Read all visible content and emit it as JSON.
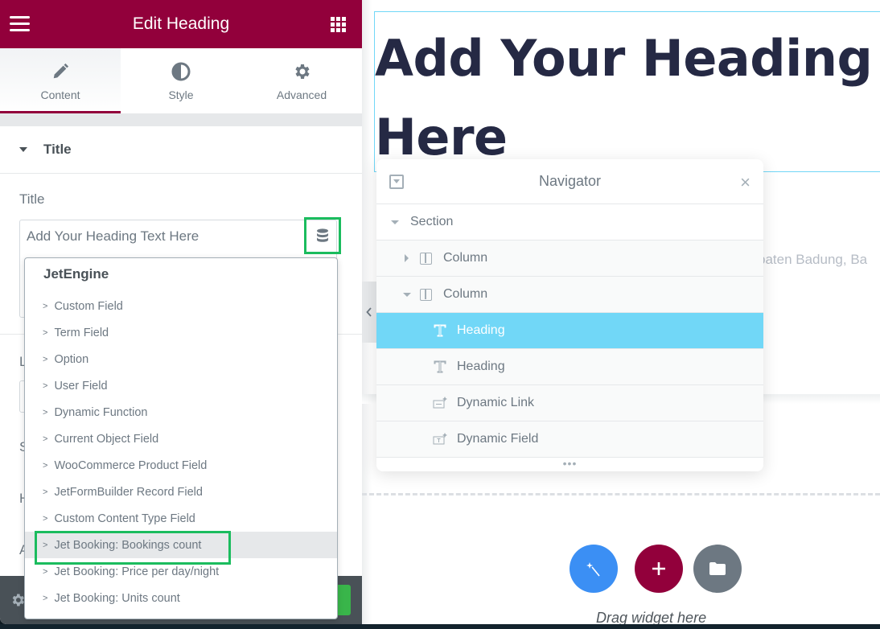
{
  "panel": {
    "title": "Edit Heading",
    "tabs": [
      {
        "label": "Content",
        "icon": "pencil-icon",
        "active": true
      },
      {
        "label": "Style",
        "icon": "contrast-icon",
        "active": false
      },
      {
        "label": "Advanced",
        "icon": "gear-icon",
        "active": false
      }
    ],
    "section": {
      "title": "Title"
    },
    "title_control": {
      "label": "Title",
      "value": "Add Your Heading Text Here",
      "dynamic_icon": "database-icon"
    },
    "hidden_labels": [
      "L",
      "S",
      "H",
      "A"
    ]
  },
  "dropdown": {
    "group": "JetEngine",
    "items": [
      {
        "label": "Custom Field"
      },
      {
        "label": "Term Field"
      },
      {
        "label": "Option"
      },
      {
        "label": "User Field"
      },
      {
        "label": "Dynamic Function"
      },
      {
        "label": "Current Object Field"
      },
      {
        "label": "WooCommerce Product Field"
      },
      {
        "label": "JetFormBuilder Record Field"
      },
      {
        "label": "Custom Content Type Field"
      },
      {
        "label": "Jet Booking: Bookings count",
        "highlighted": true
      },
      {
        "label": "Jet Booking: Price per day/night"
      },
      {
        "label": "Jet Booking: Units count"
      }
    ],
    "arrow": ">"
  },
  "canvas": {
    "heading_line1": "Add Your Heading T",
    "heading_line2": "Here",
    "address_fragment": "paten Badung, Ba",
    "drag_text": "Drag widget here",
    "buttons": [
      {
        "name": "ai-magic-button",
        "icon": "magic-wand-icon",
        "color": "#3b8ff4"
      },
      {
        "name": "add-section-button",
        "icon": "plus-icon",
        "color": "#92003b"
      },
      {
        "name": "template-library-button",
        "icon": "folder-icon",
        "color": "#6d7882"
      }
    ]
  },
  "navigator": {
    "title": "Navigator",
    "close": "×",
    "dots": "•••",
    "rows": [
      {
        "label": "Section",
        "type": "section"
      },
      {
        "label": "Column",
        "type": "column-collapsed"
      },
      {
        "label": "Column",
        "type": "column-expanded"
      },
      {
        "label": "Heading",
        "type": "heading",
        "selected": true
      },
      {
        "label": "Heading",
        "type": "heading"
      },
      {
        "label": "Dynamic Link",
        "type": "dynamic-link"
      },
      {
        "label": "Dynamic Field",
        "type": "dynamic-field"
      }
    ]
  },
  "colors": {
    "brand": "#92003b",
    "highlight_box": "#1bbc5e",
    "selected": "#71d7f7",
    "heading_text": "#252944"
  }
}
